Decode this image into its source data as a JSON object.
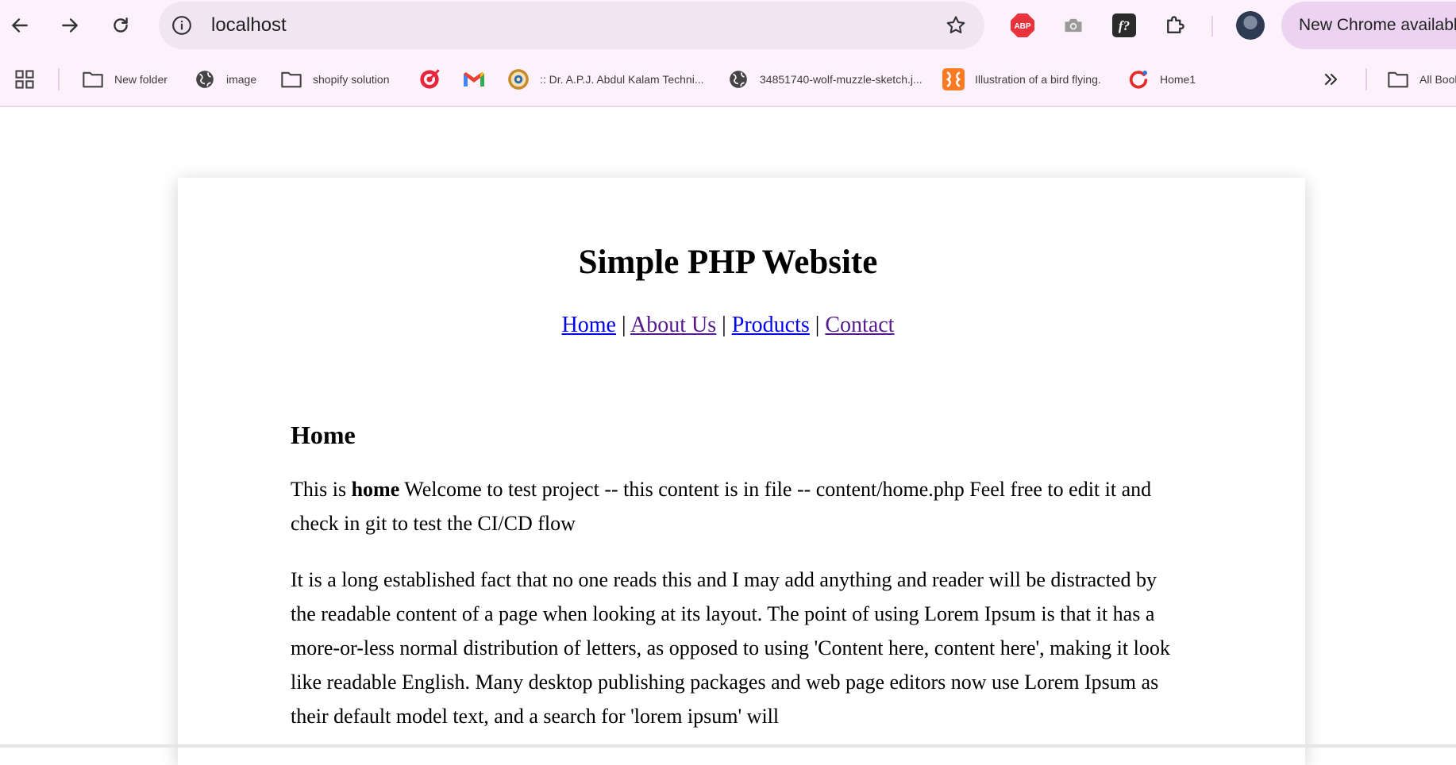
{
  "browser": {
    "url": "localhost",
    "update_label": "New Chrome available",
    "bookmarks": [
      {
        "label": "New folder",
        "icon": "folder-icon"
      },
      {
        "label": "image",
        "icon": "globe-icon"
      },
      {
        "label": "shopify solution",
        "icon": "folder-icon"
      },
      {
        "label": "",
        "icon": "red-target-icon"
      },
      {
        "label": "",
        "icon": "gmail-icon"
      },
      {
        "label": ":: Dr. A.P.J. Abdul Kalam Techni...",
        "icon": "university-seal-icon"
      },
      {
        "label": "34851740-wolf-muzzle-sketch.j...",
        "icon": "globe-icon"
      },
      {
        "label": "Illustration of a bird flying.",
        "icon": "xampp-icon"
      },
      {
        "label": "Home1",
        "icon": "red-swirl-icon"
      }
    ],
    "all_bookmarks_label": "All Bookmarks",
    "extensions": [
      "abp-icon",
      "camera-icon",
      "font-ninja-icon",
      "puzzle-icon"
    ],
    "colors": {
      "toolbar_bg": "#fdf2fb",
      "omnibox_bg": "#f1e5f1",
      "update_pill_bg": "#ecd3f2"
    }
  },
  "site": {
    "title": "Simple PHP Website",
    "nav": [
      {
        "label": "Home",
        "state": "unvisited"
      },
      {
        "label": "About Us",
        "state": "visited"
      },
      {
        "label": "Products",
        "state": "unvisited"
      },
      {
        "label": "Contact",
        "state": "visited"
      }
    ],
    "separator": "|",
    "content": {
      "heading": "Home",
      "p1_prefix": "This is ",
      "p1_bold": "home",
      "p1_suffix": " Welcome to test project -- this content is in file -- content/home.php Feel free to edit it and check in git to test the CI/CD flow",
      "p2": "It is a long established fact that no one reads this and I may add anything and reader will be distracted by the readable content of a page when looking at its layout. The point of using Lorem Ipsum is that it has a more-or-less normal distribution of letters, as opposed to using 'Content here, content here', making it look like readable English. Many desktop publishing packages and web page editors now use Lorem Ipsum as their default model text, and a search for 'lorem ipsum' will"
    }
  }
}
